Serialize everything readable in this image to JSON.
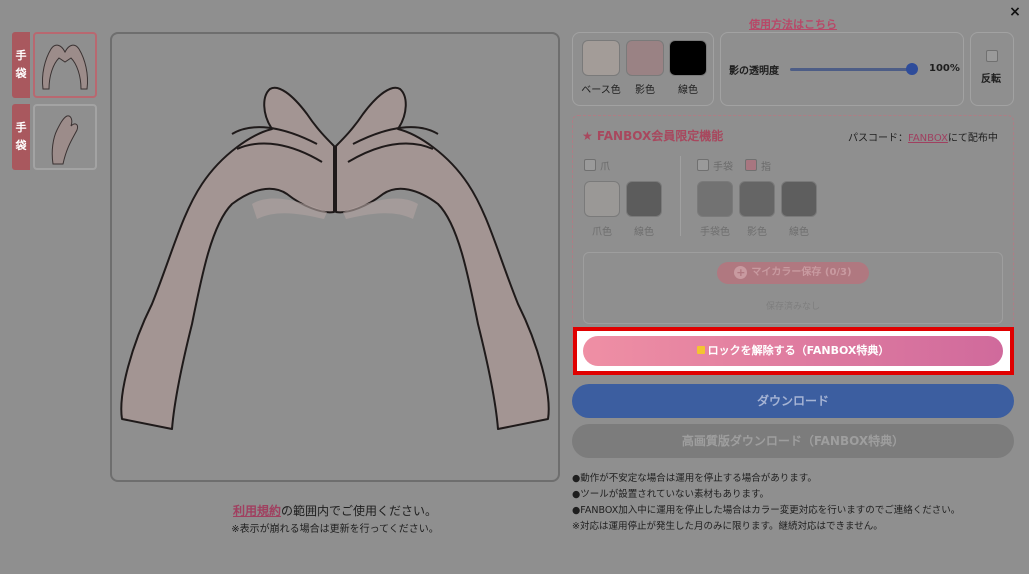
{
  "close_label": "×",
  "howto_link": "使用方法はこちら",
  "thumbnails": [
    {
      "tag_chars": [
        "手",
        "袋"
      ]
    },
    {
      "tag_chars": [
        "手",
        "袋"
      ]
    }
  ],
  "terms": {
    "link": "利用規約",
    "text": "の範囲内でご使用ください。",
    "note": "※表示が崩れる場合は更新を行ってください。"
  },
  "colors": {
    "base_label": "ベース色",
    "shadow_label": "影色",
    "line_label": "線色",
    "base_hex": "#a39c98",
    "shadow_hex": "#9a8284",
    "line_hex": "#000000"
  },
  "shadow_opacity": {
    "label": "影の透明度",
    "value_text": "100%",
    "value": 100
  },
  "flip_label": "反転",
  "fanbox": {
    "title": "★ FANBOX会員限定機能",
    "passcode_prefix": "パスコード：",
    "passcode_link": "FANBOX",
    "passcode_suffix": "にて配布中",
    "nail_label": "爪",
    "glove_label": "手袋",
    "finger_label": "指",
    "nail_color_label": "爪色",
    "nail_line_label": "線色",
    "glove_color_label": "手袋色",
    "glove_shadow_label": "影色",
    "glove_line_label": "線色",
    "mycolor_label": "マイカラー保存 (0/3)",
    "saved_none": "保存済みなし",
    "unlock_label": "ロックを解除する（FANBOX特典）"
  },
  "download_label": "ダウンロード",
  "hq_download_label": "高画質版ダウンロード（FANBOX特典）",
  "notes": [
    "●動作が不安定な場合は運用を停止する場合があります。",
    "●ツールが設置されていない素材もあります。",
    "●FANBOX加入中に運用を停止した場合はカラー変更対応を行いますのでご連絡ください。",
    "※対応は運用停止が発生した月のみに限ります。継続対応はできません。"
  ]
}
